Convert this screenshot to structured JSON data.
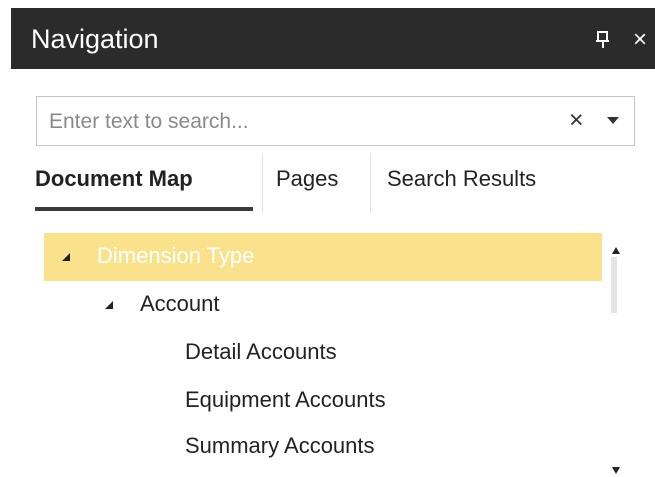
{
  "panel": {
    "title": "Navigation",
    "pin_icon": "pin-icon",
    "close_icon": "close-icon",
    "close_glyph": "×"
  },
  "search": {
    "placeholder": "Enter text to search...",
    "value": "",
    "clear_glyph": "×",
    "dropdown_icon": "chevron-down-icon"
  },
  "tabs": [
    {
      "label": "Document Map",
      "active": true
    },
    {
      "label": "Pages",
      "active": false
    },
    {
      "label": "Search Results",
      "active": false
    }
  ],
  "tree": [
    {
      "label": "Dimension Type",
      "expanded": true,
      "selected": true
    },
    {
      "label": "Account",
      "expanded": true,
      "selected": false
    },
    {
      "label": "Detail Accounts",
      "selected": false
    },
    {
      "label": "Equipment Accounts",
      "selected": false
    },
    {
      "label": "Summary Accounts",
      "selected": false
    }
  ],
  "colors": {
    "titlebar": "#2b2b2b",
    "selection": "#fae28c",
    "selected_text": "#ffffff"
  }
}
